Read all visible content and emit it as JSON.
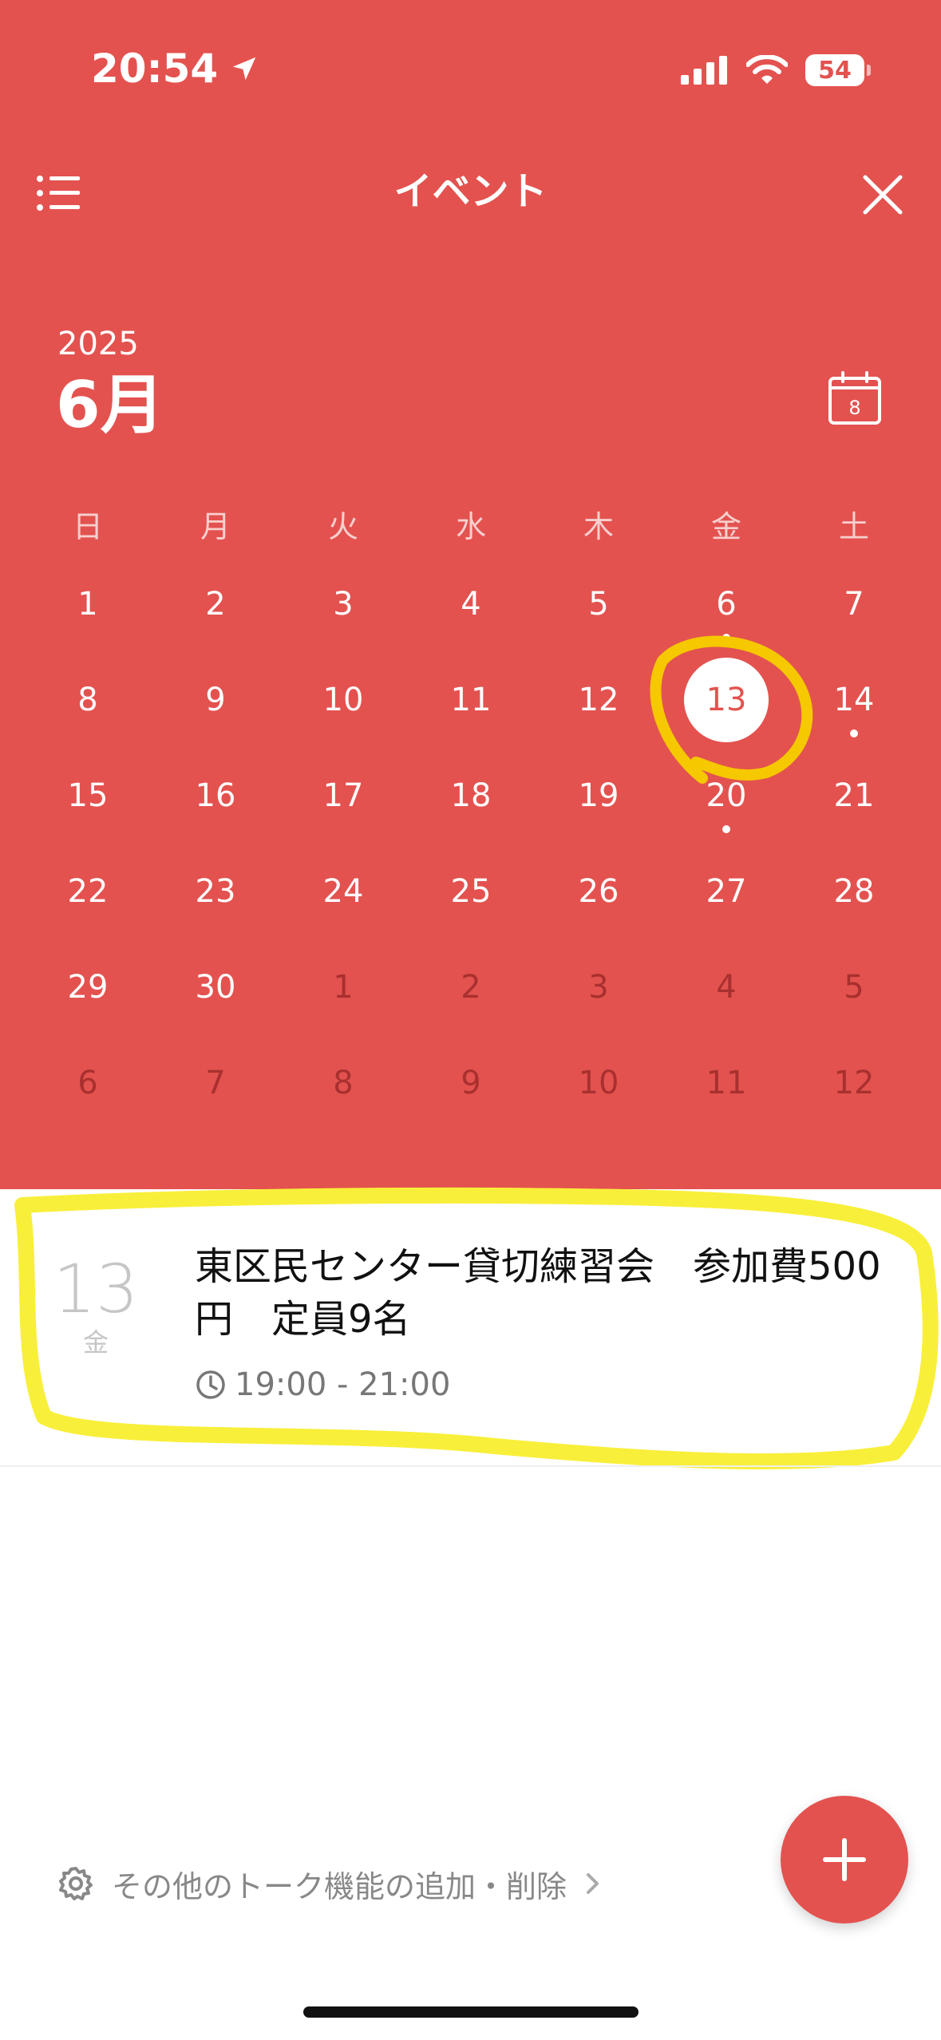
{
  "status_bar": {
    "time": "20:54",
    "battery": "54"
  },
  "header": {
    "title": "イベント"
  },
  "calendar": {
    "year": "2025",
    "month": "6月",
    "today_icon_day": "8",
    "weekdays": [
      "日",
      "月",
      "火",
      "水",
      "木",
      "金",
      "土"
    ],
    "weeks": [
      [
        {
          "d": "1",
          "cur": true
        },
        {
          "d": "2",
          "cur": true
        },
        {
          "d": "3",
          "cur": true
        },
        {
          "d": "4",
          "cur": true
        },
        {
          "d": "5",
          "cur": true
        },
        {
          "d": "6",
          "cur": true,
          "dot": true
        },
        {
          "d": "7",
          "cur": true
        }
      ],
      [
        {
          "d": "8",
          "cur": true
        },
        {
          "d": "9",
          "cur": true
        },
        {
          "d": "10",
          "cur": true
        },
        {
          "d": "11",
          "cur": true
        },
        {
          "d": "12",
          "cur": true
        },
        {
          "d": "13",
          "cur": true,
          "selected": true
        },
        {
          "d": "14",
          "cur": true,
          "dot": true
        }
      ],
      [
        {
          "d": "15",
          "cur": true
        },
        {
          "d": "16",
          "cur": true
        },
        {
          "d": "17",
          "cur": true
        },
        {
          "d": "18",
          "cur": true
        },
        {
          "d": "19",
          "cur": true
        },
        {
          "d": "20",
          "cur": true,
          "dot": true
        },
        {
          "d": "21",
          "cur": true
        }
      ],
      [
        {
          "d": "22",
          "cur": true
        },
        {
          "d": "23",
          "cur": true
        },
        {
          "d": "24",
          "cur": true
        },
        {
          "d": "25",
          "cur": true
        },
        {
          "d": "26",
          "cur": true
        },
        {
          "d": "27",
          "cur": true
        },
        {
          "d": "28",
          "cur": true
        }
      ],
      [
        {
          "d": "29",
          "cur": true
        },
        {
          "d": "30",
          "cur": true
        },
        {
          "d": "1",
          "cur": false
        },
        {
          "d": "2",
          "cur": false
        },
        {
          "d": "3",
          "cur": false
        },
        {
          "d": "4",
          "cur": false
        },
        {
          "d": "5",
          "cur": false
        }
      ],
      [
        {
          "d": "6",
          "cur": false
        },
        {
          "d": "7",
          "cur": false
        },
        {
          "d": "8",
          "cur": false
        },
        {
          "d": "9",
          "cur": false
        },
        {
          "d": "10",
          "cur": false
        },
        {
          "d": "11",
          "cur": false
        },
        {
          "d": "12",
          "cur": false
        }
      ]
    ]
  },
  "event": {
    "day": "13",
    "weekday": "金",
    "title": "東区民センター貸切練習会　参加費500円　定員9名",
    "time": "19:00 - 21:00"
  },
  "footer": {
    "link_label": "その他のトーク機能の追加・削除"
  },
  "colors": {
    "accent": "#e3524f",
    "annotation": "#f5e630"
  }
}
